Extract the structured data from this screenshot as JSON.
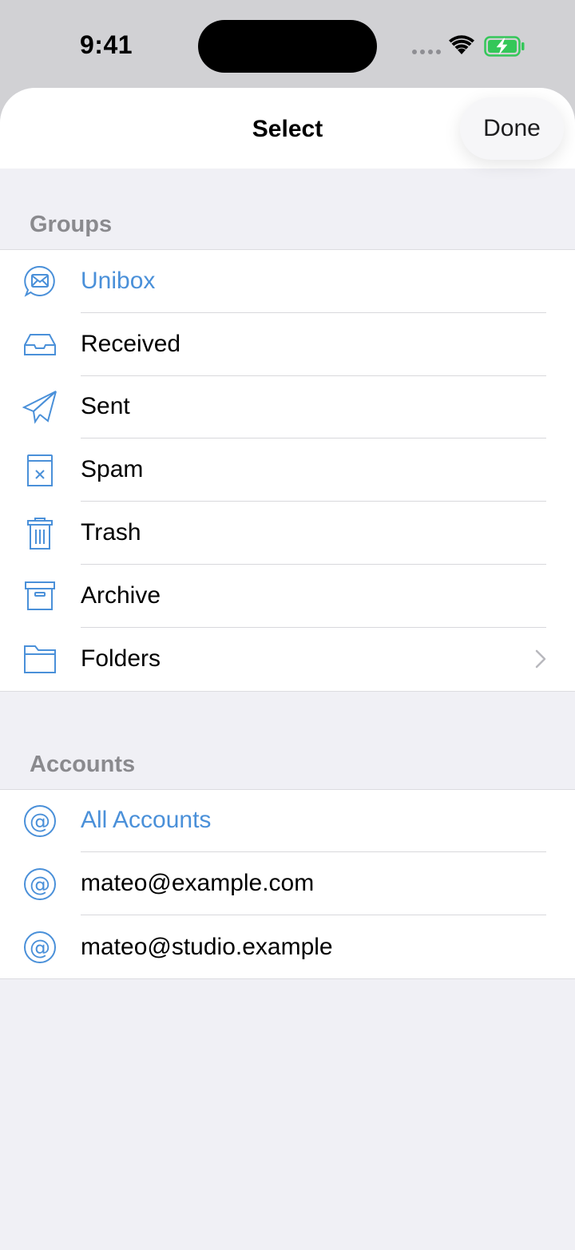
{
  "status_bar": {
    "time": "9:41",
    "battery_color": "#34c759"
  },
  "nav": {
    "title": "Select",
    "done_label": "Done"
  },
  "groups": {
    "header": "Groups",
    "items": [
      {
        "label": "Unibox",
        "icon": "unibox-icon",
        "selected": true
      },
      {
        "label": "Received",
        "icon": "inbox-tray-icon"
      },
      {
        "label": "Sent",
        "icon": "paper-plane-icon"
      },
      {
        "label": "Spam",
        "icon": "spam-bin-icon"
      },
      {
        "label": "Trash",
        "icon": "trash-icon"
      },
      {
        "label": "Archive",
        "icon": "archive-box-icon"
      },
      {
        "label": "Folders",
        "icon": "folder-icon",
        "has_chevron": true
      }
    ]
  },
  "accounts": {
    "header": "Accounts",
    "items": [
      {
        "label": "All Accounts",
        "icon": "at-sign-icon",
        "selected": true
      },
      {
        "label": "mateo@example.com",
        "icon": "at-sign-icon"
      },
      {
        "label": "mateo@studio.example",
        "icon": "at-sign-icon"
      }
    ]
  },
  "colors": {
    "accent": "#4a90d9",
    "background": "#f0f0f5",
    "secondary_text": "#8a8a8e"
  }
}
